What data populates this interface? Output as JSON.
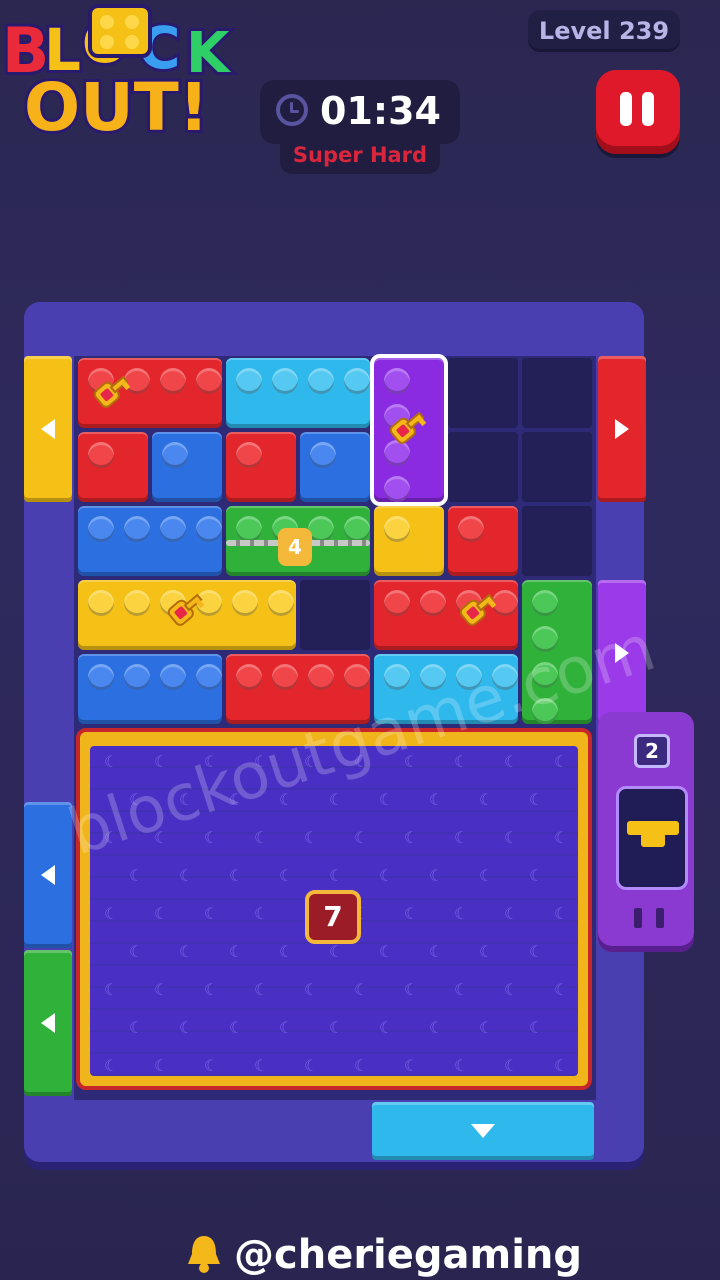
{
  "logo": {
    "line1": "BLOCK",
    "line2": "OUT!"
  },
  "header": {
    "level": "Level 239",
    "timer": "01:34",
    "difficulty": "Super Hard"
  },
  "board": {
    "lock_count": "4",
    "target_count": "7",
    "dispenser_count": "2"
  },
  "watermark": "blockoutgame.com",
  "footer": {
    "handle": "@cheriegaming"
  },
  "colors": {
    "red": "#e3262b",
    "blue": "#2b6fe0",
    "cyan": "#2fb8ec",
    "green": "#2fb13a",
    "yellow": "#f5c116",
    "purple": "#8a2be2"
  }
}
